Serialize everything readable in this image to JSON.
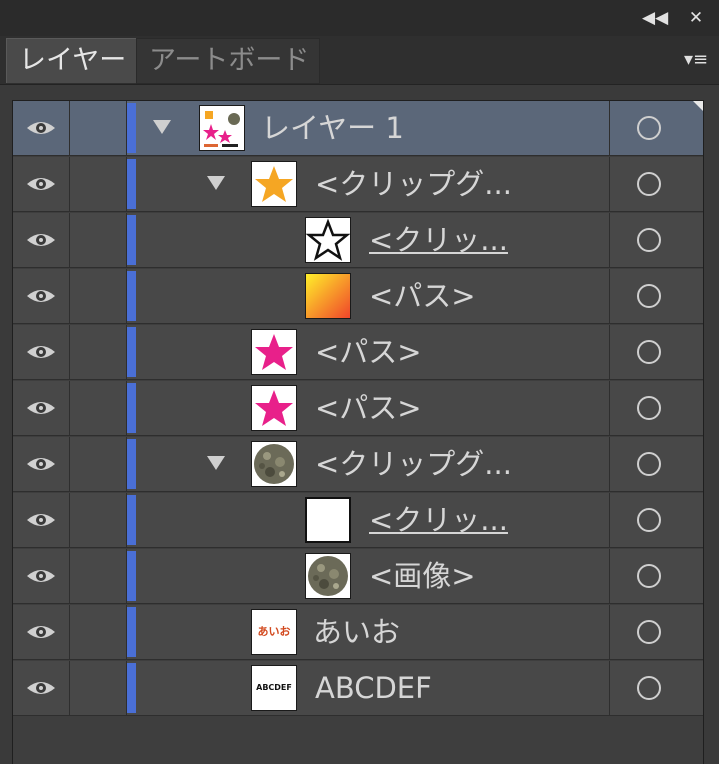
{
  "titlebar": {
    "collapse_glyph": "◀◀",
    "close_glyph": "✕"
  },
  "tabs": [
    {
      "label": "レイヤー",
      "active": true
    },
    {
      "label": "アートボード",
      "active": false
    }
  ],
  "panel_menu_glyph": "▾≡",
  "colors": {
    "layer_color": "#4a6fd6",
    "selected_row": "#5b6779",
    "magenta": "#e8208a",
    "orange": "#f5a623"
  },
  "rows": [
    {
      "name": "レイヤー 1",
      "thumb": "layer-thumb",
      "underline": false,
      "expanded": true
    },
    {
      "name": "<クリップグ...",
      "thumb": "star-orange-thumb",
      "underline": false,
      "expanded": true
    },
    {
      "name": "<クリッ...",
      "thumb": "star-outline-thumb",
      "underline": true,
      "expanded": false
    },
    {
      "name": "<パス>",
      "thumb": "gradient-thumb",
      "underline": false,
      "expanded": false
    },
    {
      "name": "<パス>",
      "thumb": "star-magenta-thumb",
      "underline": false,
      "expanded": false
    },
    {
      "name": "<パス>",
      "thumb": "star-magenta-thumb",
      "underline": false,
      "expanded": false
    },
    {
      "name": "<クリップグ...",
      "thumb": "texture-circle-thumb",
      "underline": false,
      "expanded": true
    },
    {
      "name": "<クリッ...",
      "thumb": "white-rect-thumb",
      "underline": true,
      "expanded": false
    },
    {
      "name": "<画像>",
      "thumb": "texture-circle-thumb",
      "underline": false,
      "expanded": false
    },
    {
      "name": "あいお",
      "thumb": "text-aio-thumb",
      "thumb_text": "あいお",
      "underline": false,
      "expanded": false
    },
    {
      "name": "ABCDEF",
      "thumb": "text-abc-thumb",
      "thumb_text": "ABCDEF",
      "underline": false,
      "expanded": false
    }
  ]
}
